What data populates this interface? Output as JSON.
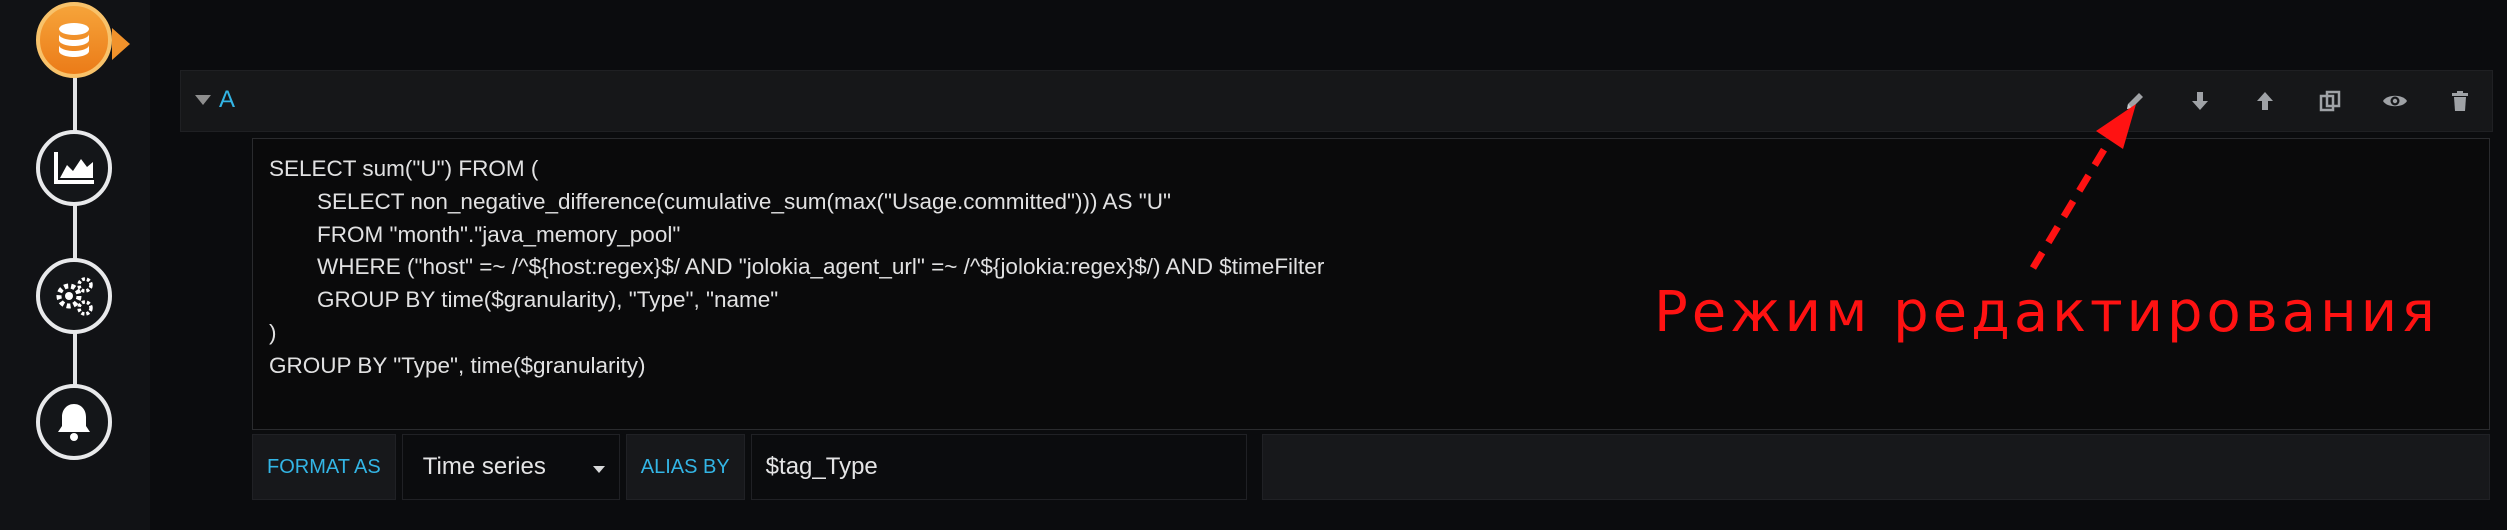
{
  "query": {
    "ref_id": "A",
    "lines": [
      "SELECT sum(\"U\") FROM (",
      "SELECT non_negative_difference(cumulative_sum(max(\"Usage.committed\"))) AS \"U\"",
      "FROM \"month\".\"java_memory_pool\"",
      "WHERE (\"host\" =~ /^${host:regex}$/ AND \"jolokia_agent_url\" =~ /^${jolokia:regex}$/) AND $timeFilter",
      "GROUP BY time($granularity), \"Type\", \"name\"",
      ")",
      "GROUP BY \"Type\", time($granularity)"
    ]
  },
  "options": {
    "format_as_label": "FORMAT AS",
    "format_as_value": "Time series",
    "alias_by_label": "ALIAS BY",
    "alias_by_value": "$tag_Type"
  },
  "annotation": {
    "text": "Режим  редактирования",
    "color": "#ff1212"
  },
  "row_actions": [
    "pencil-icon",
    "arrow-down-icon",
    "arrow-up-icon",
    "duplicate-icon",
    "eye-icon",
    "trash-icon"
  ],
  "sidebar_icons": [
    "database-icon",
    "chart-icon",
    "gears-icon",
    "bell-icon"
  ],
  "colors": {
    "accent": "#33b5e5",
    "active_orange": "#f1922b",
    "background": "#0b0c0e"
  }
}
